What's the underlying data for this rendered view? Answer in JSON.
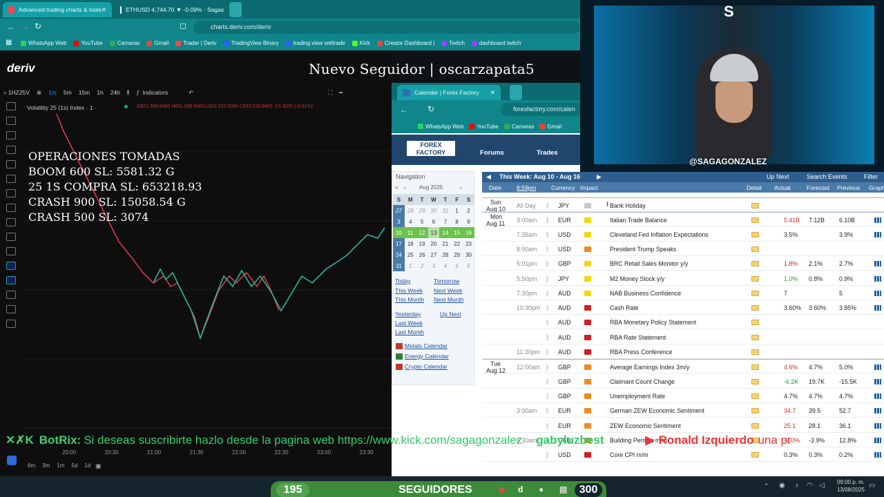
{
  "browser": {
    "tabs": [
      {
        "title": "Advanced trading charts & tools"
      },
      {
        "title": "ETHUSD 4,744.70 ▼ -0.09% · Sagas"
      }
    ],
    "url": "charts.deriv.com/deriv",
    "bookmarks": [
      "WhatsApp Web",
      "YouTube",
      "Camaras",
      "Gmail",
      "Trader | Deriv",
      "TradingView Binary",
      "trading view weltrade",
      "Kick",
      "Creator Dashboard |",
      "Twitch",
      "dashboard twitch"
    ]
  },
  "deriv": {
    "logo": "deriv",
    "overlay_follower": "Nuevo Seguidor | oscarzapata5",
    "symbol_search": "1HZ25V",
    "timeframes": [
      "1m",
      "5m",
      "15m",
      "1h",
      "24h"
    ],
    "indicators_label": "Indicators",
    "instrument": "Volatility 25 (1s) Index · 1 ·",
    "ohlc": "O651,599.6400 H651,599.6400 L652,522.5000 C653,533.8400 -53.3000 (-0.01%)",
    "operations": [
      "OPERACIONES TOMADAS",
      "BOOM 600 SL: 5581.32 G",
      "25 1S COMPRA SL: 653218.93",
      "CRASH 900 SL: 15058.54 G",
      "CRASH 500 SL: 3074"
    ],
    "x_axis": [
      "20:00",
      "20:30",
      "21:00",
      "21:30",
      "22:00",
      "22:30",
      "23:00",
      "23:30"
    ],
    "range_buttons": [
      "6m",
      "3m",
      "1m",
      "5d",
      "1d"
    ]
  },
  "forexfactory": {
    "tab_title": "Calendar | Forex Factory",
    "url": "forexfactory.com/calen",
    "bookmarks": [
      "WhatsApp Web",
      "YouTube",
      "Camaras",
      "Gmail"
    ],
    "nav_items": [
      "Forums",
      "Trades"
    ],
    "navigation_title": "Navigation",
    "month": "Aug 2025",
    "weekdays": [
      "S",
      "M",
      "T",
      "W",
      "T",
      "F",
      "S"
    ],
    "calendar_rows": [
      [
        "27",
        "28",
        "29",
        "30",
        "31",
        "1",
        "2"
      ],
      [
        "3",
        "4",
        "5",
        "6",
        "7",
        "8",
        "9"
      ],
      [
        "10",
        "11",
        "12",
        "13",
        "14",
        "15",
        "16"
      ],
      [
        "17",
        "18",
        "19",
        "20",
        "21",
        "22",
        "23"
      ],
      [
        "24",
        "25",
        "26",
        "27",
        "28",
        "29",
        "30"
      ],
      [
        "31",
        "1",
        "2",
        "3",
        "4",
        "5",
        "6"
      ]
    ],
    "links": [
      "Today",
      "Tomorrow",
      "This Week",
      "Next Week",
      "This Month",
      "Next Month",
      "Yesterday",
      "Up Next",
      "Last Week",
      "Last Month"
    ],
    "special_links": [
      "Metals Calendar",
      "Energy Calendar",
      "Crypto Calendar"
    ],
    "week_title": "This Week: Aug 10 - Aug 16",
    "toolbar": [
      "Up Next",
      "Search Events",
      "Filter"
    ],
    "headers": {
      "date": "Date",
      "time": "8:59pm",
      "currency": "Currency",
      "impact": "Impact",
      "detail": "Detail",
      "actual": "Actual",
      "forecast": "Forecast",
      "previous": "Previous",
      "graph": "Graph"
    },
    "events": [
      {
        "day": "Sun",
        "date": "Aug 10",
        "time": "All Day",
        "cur": "JPY",
        "impact": "gray",
        "event": "Bank Holiday",
        "actual": "",
        "forecast": "",
        "previous": "",
        "act_color": "#222"
      },
      {
        "day": "Mon",
        "date": "Aug 11",
        "time": "3:00am",
        "cur": "EUR",
        "impact": "yellow",
        "event": "Italian Trade Balance",
        "actual": "5.41B",
        "forecast": "7.12B",
        "previous": "6.10B",
        "act_color": "#d2281e"
      },
      {
        "day": "",
        "date": "",
        "time": "7:35am",
        "cur": "USD",
        "impact": "yellow",
        "event": "Cleveland Fed Inflation Expectations",
        "actual": "3.5%",
        "forecast": "",
        "previous": "3.9%",
        "act_color": "#222"
      },
      {
        "day": "",
        "date": "",
        "time": "8:00am",
        "cur": "USD",
        "impact": "orange",
        "event": "President Trump Speaks",
        "actual": "",
        "forecast": "",
        "previous": "",
        "act_color": "#222"
      },
      {
        "day": "",
        "date": "",
        "time": "5:01pm",
        "cur": "GBP",
        "impact": "yellow",
        "event": "BRC Retail Sales Monitor y/y",
        "actual": "1.8%",
        "forecast": "2.1%",
        "previous": "2.7%",
        "act_color": "#d2281e"
      },
      {
        "day": "",
        "date": "",
        "time": "5:50pm",
        "cur": "JPY",
        "impact": "yellow",
        "event": "M2 Money Stock y/y",
        "actual": "1.0%",
        "forecast": "0.8%",
        "previous": "0.9%",
        "act_color": "#2a9a2a"
      },
      {
        "day": "",
        "date": "",
        "time": "7:30pm",
        "cur": "AUD",
        "impact": "yellow",
        "event": "NAB Business Confidence",
        "actual": "7",
        "forecast": "",
        "previous": "5",
        "act_color": "#222"
      },
      {
        "day": "",
        "date": "",
        "time": "10:30pm",
        "cur": "AUD",
        "impact": "red",
        "event": "Cash Rate",
        "actual": "3.60%",
        "forecast": "3.60%",
        "previous": "3.85%",
        "act_color": "#222"
      },
      {
        "day": "",
        "date": "",
        "time": "",
        "cur": "AUD",
        "impact": "red",
        "event": "RBA Monetary Policy Statement",
        "actual": "",
        "forecast": "",
        "previous": "",
        "act_color": "#222"
      },
      {
        "day": "",
        "date": "",
        "time": "",
        "cur": "AUD",
        "impact": "red",
        "event": "RBA Rate Statement",
        "actual": "",
        "forecast": "",
        "previous": "",
        "act_color": "#222"
      },
      {
        "day": "",
        "date": "",
        "time": "11:30pm",
        "cur": "AUD",
        "impact": "red",
        "event": "RBA Press Conference",
        "actual": "",
        "forecast": "",
        "previous": "",
        "act_color": "#222"
      },
      {
        "day": "Tue",
        "date": "Aug 12",
        "time": "12:00am",
        "cur": "GBP",
        "impact": "orange",
        "event": "Average Earnings Index 3m/y",
        "actual": "4.6%",
        "forecast": "4.7%",
        "previous": "5.0%",
        "act_color": "#d2281e"
      },
      {
        "day": "",
        "date": "",
        "time": "",
        "cur": "GBP",
        "impact": "orange",
        "event": "Claimant Count Change",
        "actual": "-6.2K",
        "forecast": "19.7K",
        "previous": "-15.5K",
        "act_color": "#2a9a2a"
      },
      {
        "day": "",
        "date": "",
        "time": "",
        "cur": "GBP",
        "impact": "orange",
        "event": "Unemployment Rate",
        "actual": "4.7%",
        "forecast": "4.7%",
        "previous": "4.7%",
        "act_color": "#222"
      },
      {
        "day": "",
        "date": "",
        "time": "3:00am",
        "cur": "EUR",
        "impact": "orange",
        "event": "German ZEW Economic Sentiment",
        "actual": "34.7",
        "forecast": "39.5",
        "previous": "52.7",
        "act_color": "#d2281e"
      },
      {
        "day": "",
        "date": "",
        "time": "",
        "cur": "EUR",
        "impact": "orange",
        "event": "ZEW Economic Sentiment",
        "actual": "25.1",
        "forecast": "28.1",
        "previous": "36.1",
        "act_color": "#d2281e"
      },
      {
        "day": "",
        "date": "",
        "time": "6:30am",
        "cur": "CAD",
        "impact": "orange",
        "event": "Building Permits m/m",
        "actual": "-9.0%",
        "forecast": "-3.9%",
        "previous": "12.8%",
        "act_color": "#d2281e"
      },
      {
        "day": "",
        "date": "",
        "time": "",
        "cur": "USD",
        "impact": "red",
        "event": "Core CPI m/m",
        "actual": "0.3%",
        "forecast": "0.3%",
        "previous": "0.2%",
        "act_color": "#222"
      }
    ]
  },
  "webcam": {
    "handle": "@SAGAGONZALEZ"
  },
  "ticker": {
    "bot": "BotRix:",
    "message": "Si deseas suscribirte hazlo desde la pagina web https://www.kick.com/sagagonzalez",
    "user1": "gabyluzbest",
    "user2": "Ronald Izquierdo",
    "tail": "una pr"
  },
  "followers": {
    "current": "195",
    "label": "SEGUIDORES",
    "goal": "300"
  },
  "taskbar": {
    "time": "09:00 p. m.",
    "date": "13/08/2025"
  },
  "colors": {
    "impact": {
      "gray": "#c7c7c7",
      "yellow": "#f2d80c",
      "orange": "#f08a1c",
      "red": "#d21e1e"
    }
  }
}
